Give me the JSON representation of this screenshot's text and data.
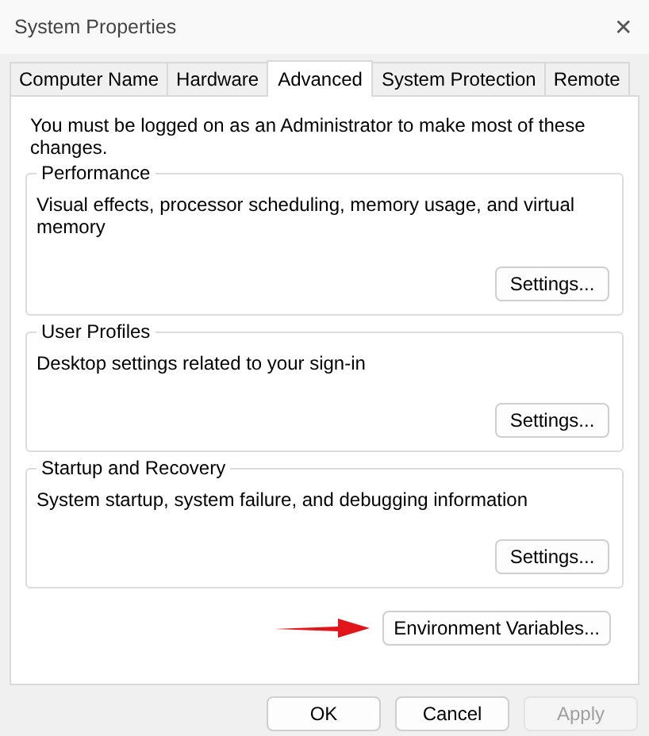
{
  "window": {
    "title": "System Properties",
    "close": "✕"
  },
  "tabs": [
    {
      "label": "Computer Name",
      "selected": false
    },
    {
      "label": "Hardware",
      "selected": false
    },
    {
      "label": "Advanced",
      "selected": true
    },
    {
      "label": "System Protection",
      "selected": false
    },
    {
      "label": "Remote",
      "selected": false
    }
  ],
  "notice": "You must be logged on as an Administrator to make most of these changes.",
  "groups": [
    {
      "title": "Performance",
      "description": "Visual effects, processor scheduling, memory usage, and virtual memory",
      "button": "Settings..."
    },
    {
      "title": "User Profiles",
      "description": "Desktop settings related to your sign-in",
      "button": "Settings..."
    },
    {
      "title": "Startup and Recovery",
      "description": "System startup, system failure, and debugging information",
      "button": "Settings..."
    }
  ],
  "environment_button": "Environment Variables...",
  "buttons": [
    {
      "label": "OK",
      "disabled": false
    },
    {
      "label": "Cancel",
      "disabled": false
    },
    {
      "label": "Apply",
      "disabled": true
    }
  ]
}
